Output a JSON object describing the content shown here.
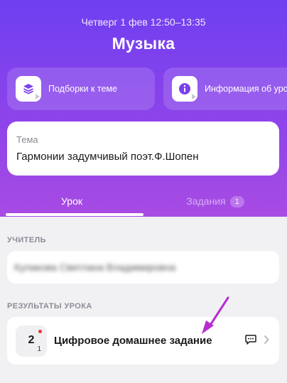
{
  "header": {
    "datetime": "Четверг 1 фев  12:50–13:35",
    "title": "Музыка"
  },
  "shortcuts": [
    {
      "label": "Подборки к теме",
      "icon": "layers-icon"
    },
    {
      "label": "Информация об уроке",
      "icon": "info-icon"
    }
  ],
  "topic": {
    "caption": "Тема",
    "value": "Гармонии задумчивый поэт.Ф.Шопен"
  },
  "tabs": {
    "lesson": "Урок",
    "tasks": "Задания",
    "tasks_count": "1"
  },
  "teacher": {
    "section_label": "УЧИТЕЛЬ",
    "name_redacted": "Кулакова Светлана Владимировна"
  },
  "results": {
    "section_label": "РЕЗУЛЬТАТЫ УРОКА",
    "grade": "2",
    "weight": "1",
    "name": "Цифровое домашнее задание"
  },
  "colors": {
    "accent": "#7a41ee",
    "annotation_arrow": "#b52fd0",
    "unread_dot": "#e8343b"
  }
}
